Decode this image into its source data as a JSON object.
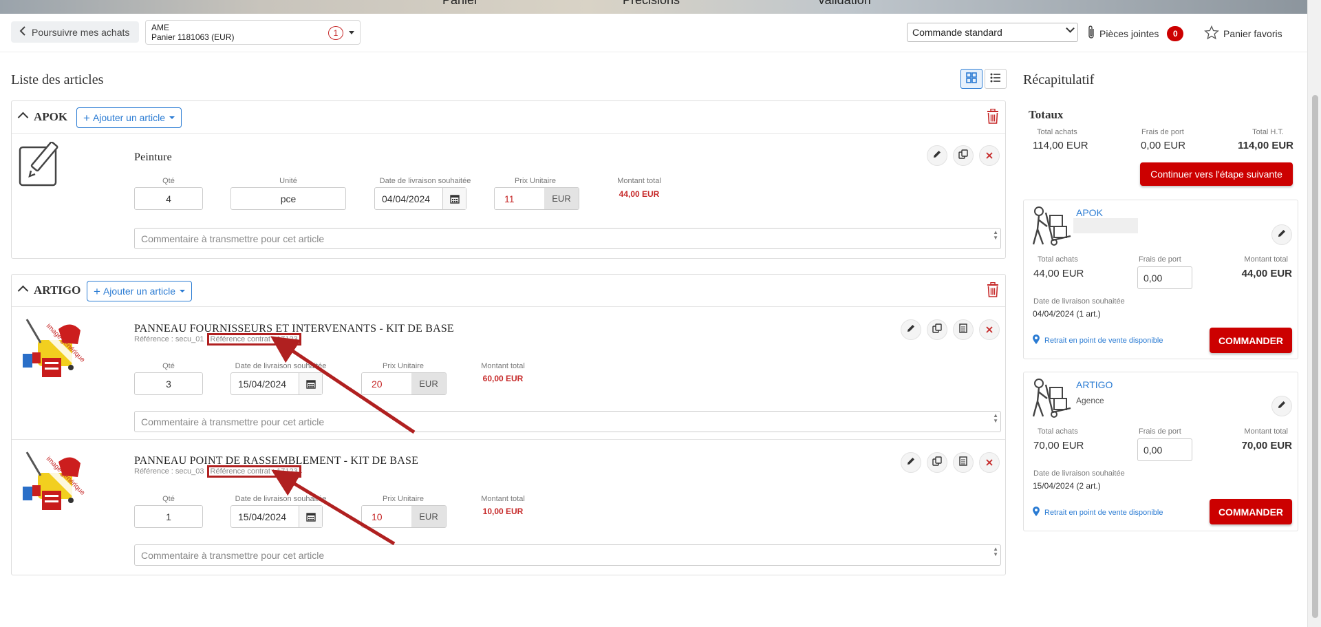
{
  "header": {
    "steps": [
      "Panier",
      "Précisions",
      "Validation"
    ]
  },
  "toolbar": {
    "back_label": "Poursuivre mes achats",
    "cart_line1": "AME",
    "cart_line2": "Panier 1181063 (EUR)",
    "cart_count": "1",
    "order_type": "Commande standard",
    "attachments_label": "Pièces jointes",
    "attachments_count": "0",
    "favorites_label": "Panier favoris"
  },
  "main": {
    "title": "Liste des articles",
    "suppliers": [
      {
        "name": "APOK",
        "add_label": "Ajouter un article",
        "articles": [
          {
            "title": "Peinture",
            "qty_label": "Qté",
            "qty": "4",
            "unit_label": "Unité",
            "unit": "pce",
            "date_label": "Date de livraison souhaitée",
            "date": "04/04/2024",
            "price_label": "Prix Unitaire",
            "price": "11",
            "currency": "EUR",
            "total_label": "Montant total",
            "total": "44,00 EUR",
            "comment_placeholder": "Commentaire à transmettre pour cet article"
          }
        ]
      },
      {
        "name": "ARTIGO",
        "add_label": "Ajouter un article",
        "articles": [
          {
            "title": "PANNEAU FOURNISSEURS ET INTERVENANTS - KIT DE BASE",
            "ref": "Référence : secu_01",
            "contract_ref": "Référence contrat : 17123",
            "image_label": "image générique",
            "qty_label": "Qté",
            "qty": "3",
            "date_label": "Date de livraison souhaitée",
            "date": "15/04/2024",
            "price_label": "Prix Unitaire",
            "price": "20",
            "currency": "EUR",
            "total_label": "Montant total",
            "total": "60,00 EUR",
            "comment_placeholder": "Commentaire à transmettre pour cet article"
          },
          {
            "title": "PANNEAU POINT DE RASSEMBLEMENT - KIT DE BASE",
            "ref": "Référence : secu_03",
            "contract_ref": "Référence contrat : 17123",
            "image_label": "image générique",
            "qty_label": "Qté",
            "qty": "1",
            "date_label": "Date de livraison souhaitée",
            "date": "15/04/2024",
            "price_label": "Prix Unitaire",
            "price": "10",
            "currency": "EUR",
            "total_label": "Montant total",
            "total": "10,00 EUR",
            "comment_placeholder": "Commentaire à transmettre pour cet article"
          }
        ]
      }
    ]
  },
  "recap": {
    "title": "Récapitulatif",
    "totals_title": "Totaux",
    "purchases_label": "Total achats",
    "purchases": "114,00 EUR",
    "shipping_label": "Frais de port",
    "shipping": "0,00 EUR",
    "total_ht_label": "Total H.T.",
    "total_ht": "114,00 EUR",
    "continue_label": "Continuer vers l'étape suivante",
    "suppliers": [
      {
        "name": "APOK",
        "subtitle": "",
        "purchases_label": "Total achats",
        "purchases": "44,00 EUR",
        "shipping_label": "Frais de port",
        "shipping": "0,00",
        "total_label": "Montant total",
        "total": "44,00 EUR",
        "date_label": "Date de livraison souhaitée",
        "date": "04/04/2024 (1 art.)",
        "pickup": "Retrait en point de vente disponible",
        "order_label": "COMMANDER"
      },
      {
        "name": "ARTIGO",
        "subtitle": "Agence",
        "purchases_label": "Total achats",
        "purchases": "70,00 EUR",
        "shipping_label": "Frais de port",
        "shipping": "0,00",
        "total_label": "Montant total",
        "total": "70,00 EUR",
        "date_label": "Date de livraison souhaitée",
        "date": "15/04/2024 (2 art.)",
        "pickup": "Retrait en point de vente disponible",
        "order_label": "COMMANDER"
      }
    ]
  },
  "colors": {
    "accent_blue": "#2a7bd3",
    "brand_red": "#cc0000",
    "price_red": "#c62828",
    "annotation_red": "#b02020"
  }
}
